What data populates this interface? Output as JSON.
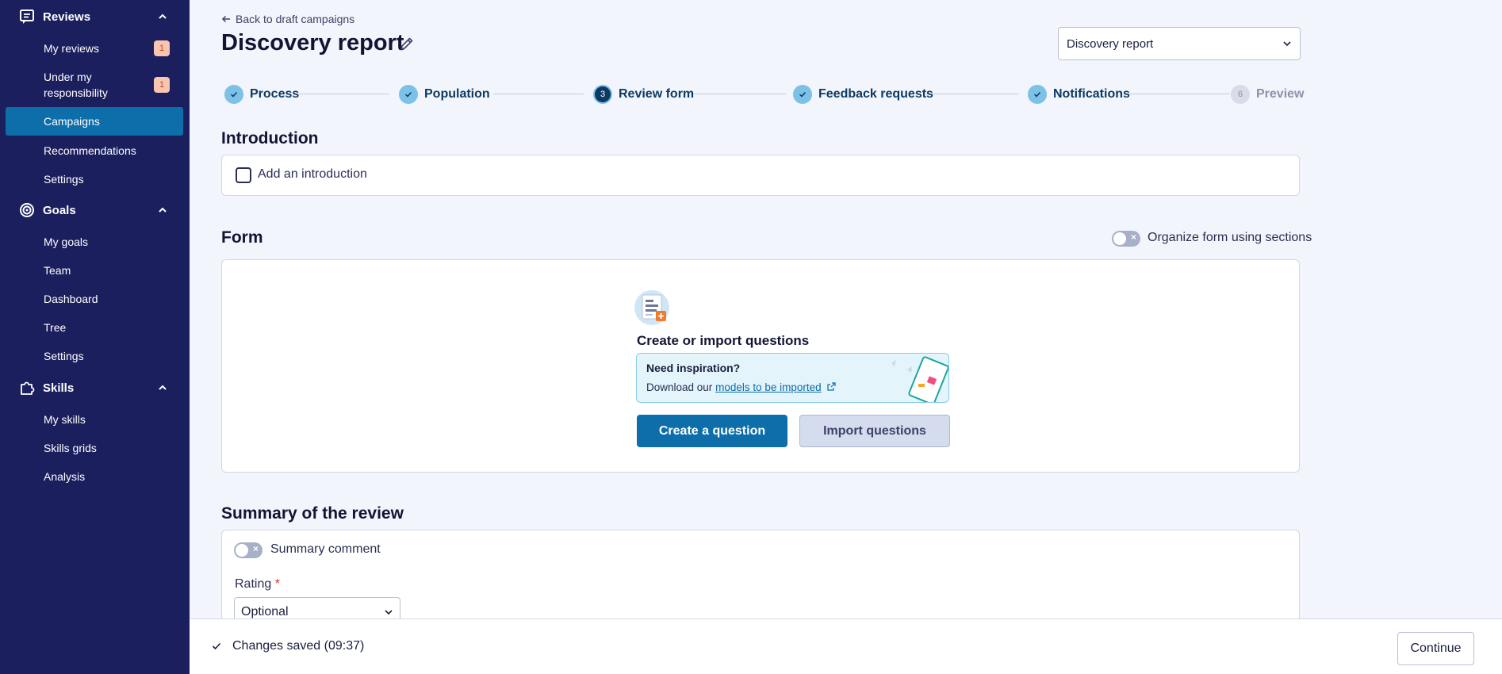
{
  "sidebar": {
    "sections": [
      {
        "label": "Reviews",
        "icon": "message-square-icon",
        "items": [
          {
            "label": "My reviews",
            "badge": "1"
          },
          {
            "label": "Under my responsibility",
            "badge": "1"
          },
          {
            "label": "Campaigns",
            "active": true
          },
          {
            "label": "Recommendations"
          },
          {
            "label": "Settings"
          }
        ]
      },
      {
        "label": "Goals",
        "icon": "target-icon",
        "items": [
          {
            "label": "My goals"
          },
          {
            "label": "Team"
          },
          {
            "label": "Dashboard"
          },
          {
            "label": "Tree"
          },
          {
            "label": "Settings"
          }
        ]
      },
      {
        "label": "Skills",
        "icon": "puzzle-icon",
        "items": [
          {
            "label": "My skills"
          },
          {
            "label": "Skills grids"
          },
          {
            "label": "Analysis"
          }
        ]
      }
    ]
  },
  "header": {
    "back_label": "Back to draft campaigns",
    "title": "Discovery report",
    "select_value": "Discovery report"
  },
  "stepper": {
    "steps": [
      {
        "label": "Process",
        "status": "done"
      },
      {
        "label": "Population",
        "status": "done"
      },
      {
        "label": "Review form",
        "number": "3",
        "status": "current"
      },
      {
        "label": "Feedback requests",
        "status": "done"
      },
      {
        "label": "Notifications",
        "status": "done"
      },
      {
        "label": "Preview",
        "number": "6",
        "status": "future"
      }
    ]
  },
  "introduction": {
    "heading": "Introduction",
    "checkbox_label": "Add an introduction",
    "checked": false
  },
  "form": {
    "heading": "Form",
    "toggle_label": "Organize form using sections",
    "toggle_on": false,
    "empty_title": "Create or import questions",
    "inspiration": {
      "title": "Need inspiration?",
      "text": "Download our",
      "link": "models to be imported"
    },
    "create_button": "Create a question",
    "import_button": "Import questions"
  },
  "summary": {
    "heading": "Summary of the review",
    "comment_toggle_label": "Summary comment",
    "comment_toggle_on": false,
    "rating_label": "Rating",
    "rating_required": "*",
    "rating_value": "Optional"
  },
  "footer": {
    "saved_text": "Changes saved (09:37)",
    "continue_label": "Continue"
  },
  "colors": {
    "sidebar_bg": "#1b1f5e",
    "accent": "#0d6eaa",
    "step_done": "#7cc1e6",
    "step_current": "#0d3a63"
  }
}
